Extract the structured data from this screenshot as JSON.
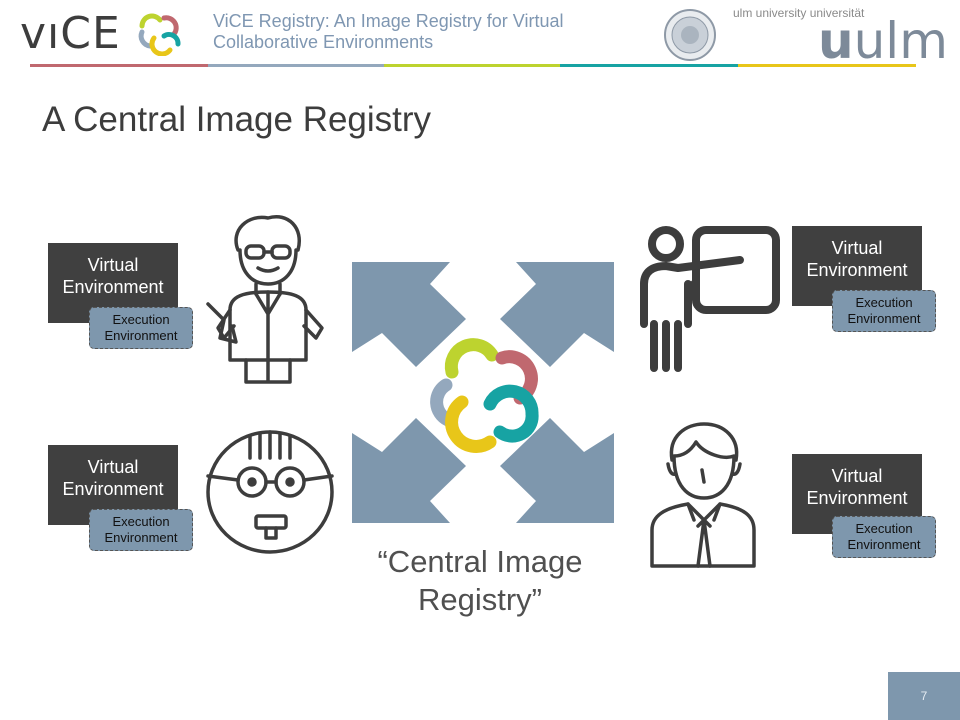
{
  "header": {
    "logo_text": "vıCE",
    "title": "ViCE Registry: An Image Registry for Virtual Collaborative Environments",
    "university_small": "ulm university  universität",
    "university_big_bold": "u",
    "university_big_rest": "ulm"
  },
  "slide": {
    "title": "A Central Image Registry",
    "caption_line1": "“Central Image",
    "caption_line2": "Registry”",
    "page_number": "7"
  },
  "boxes": {
    "virtual_line1": "Virtual",
    "virtual_line2": "Environment",
    "execution_line1": "Execution",
    "execution_line2": "Environment"
  },
  "colors": {
    "arrow": "#7e97ad",
    "box_dark": "#404040",
    "box_blue": "#7e97ad",
    "ring_yellow": "#e8c619",
    "ring_red": "#c0686f",
    "ring_teal": "#17a3a3",
    "ring_gray": "#94a8bd",
    "ring_green": "#bdd32f",
    "bar_colors": [
      "#c0686f",
      "#94a8bd",
      "#bdd32f",
      "#17a3a3",
      "#e8c619"
    ]
  }
}
